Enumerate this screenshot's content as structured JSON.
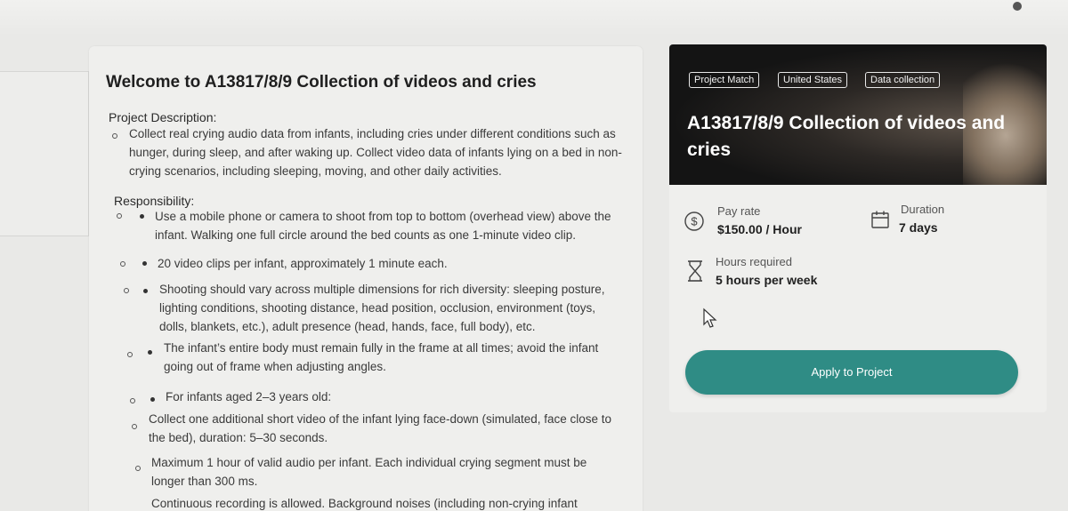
{
  "header": {
    "title": "Welcome to A13817/8/9 Collection of videos and cries"
  },
  "description": {
    "label": "Project Description",
    "colon": ":",
    "text": "Collect real crying audio data from infants, including cries under different conditions such as hunger, during sleep, and after waking up. Collect video data of infants lying on a bed in non-crying scenarios, including sleeping, moving, and other daily activities."
  },
  "responsibility": {
    "label": "Responsibility:",
    "items": [
      "Use a mobile phone or camera to shoot from top to bottom (overhead view) above the infant. Walking one full circle around the bed counts as one 1-minute video clip.",
      "20 video clips per infant, approximately 1 minute each.",
      "Shooting should vary across multiple dimensions for rich diversity: sleeping posture, lighting conditions, shooting distance, head position, occlusion, environment (toys, dolls, blankets, etc.), adult presence (head, hands, face, full body), etc.",
      "The infant’s entire body must remain fully in the frame at all times; avoid the infant going out of frame when adjusting angles.",
      "For infants aged 2–3 years old:",
      "Collect one additional short video of the infant lying face-down (simulated, face close to the bed), duration: 5–30 seconds.",
      "Maximum 1 hour of valid audio per infant. Each individual crying segment must be longer than 300 ms.",
      "Continuous recording is allowed. Background noises (including non-crying infant"
    ]
  },
  "project": {
    "tags": [
      "Project Match",
      "United States",
      "Data collection"
    ],
    "title": "A13817/8/9 Collection of videos and cries",
    "pay_rate_label": "Pay rate",
    "pay_rate_value": "$150.00 / Hour",
    "duration_label": "Duration",
    "duration_value": "7 days",
    "hours_label": "Hours required",
    "hours_value": "5 hours per week",
    "apply_label": "Apply to Project"
  },
  "colors": {
    "accent": "#2f8c85",
    "background": "#e9e9e7",
    "hero": "#141414"
  },
  "icons": [
    "dollar-icon",
    "calendar-icon",
    "hourglass-icon",
    "cursor-icon"
  ]
}
